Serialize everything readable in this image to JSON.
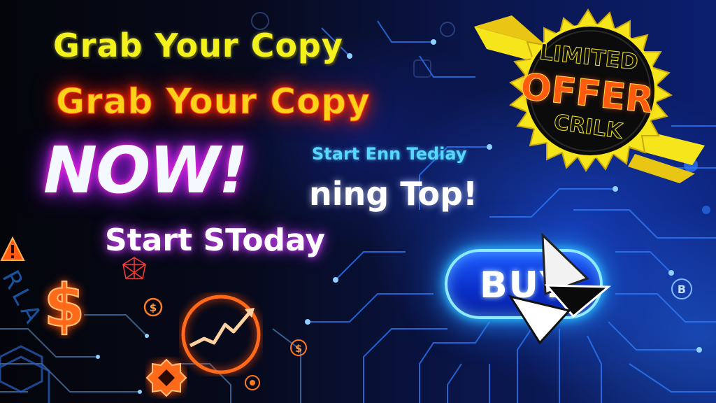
{
  "headlines": {
    "grab_small": "Grab Your Copy",
    "grab_large": "Grab Your Copy",
    "now": "NOW!",
    "start_small": "Start Enn Tediay",
    "ning_top": "ning Top!",
    "start_today": "Start SToday"
  },
  "badge": {
    "line1": "LIMITED",
    "line2": "OFFER",
    "line3": "CRILK"
  },
  "buy_button": {
    "label": "BUY"
  },
  "decor": {
    "scroll_letters": "RLA",
    "icons": [
      "warning-icon",
      "dollar-icon",
      "coin-icon",
      "growth-chart-icon",
      "bitcoin-icon",
      "gear-icon",
      "cursor-arrow-icon"
    ]
  },
  "colors": {
    "yellow": "#f4f21c",
    "red_glow": "#ff2a00",
    "magenta_glow": "#c51cff",
    "cyan": "#58d8ff",
    "button_blue": "#1d5cff",
    "badge_yellow": "#f5e51a",
    "orange": "#ff5a10"
  }
}
